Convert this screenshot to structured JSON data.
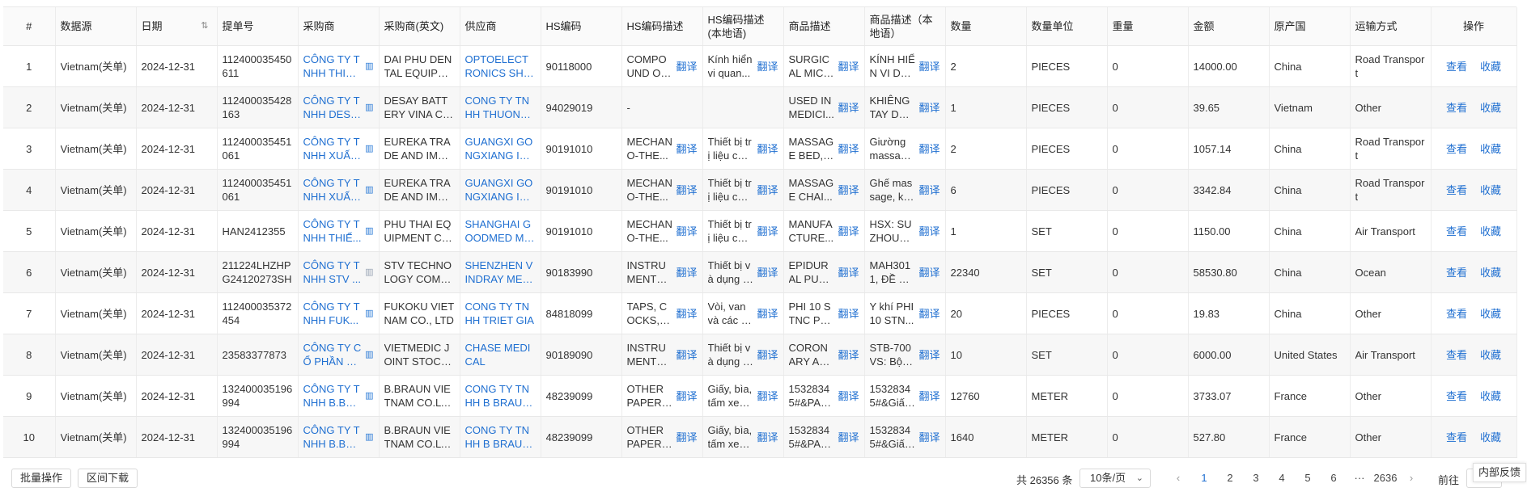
{
  "table": {
    "columns": [
      "#",
      "数据源",
      "日期",
      "提单号",
      "采购商",
      "采购商(英文)",
      "供应商",
      "HS编码",
      "HS编码描述",
      "HS编码描述\n(本地语)",
      "商品描述",
      "商品描述（本地语）",
      "数量",
      "数量单位",
      "重量",
      "金额",
      "原产国",
      "运输方式",
      "操作"
    ],
    "translate_label": "翻译",
    "view_label": "查看",
    "fav_label": "收藏",
    "rows": [
      {
        "no": "1",
        "source": "Vietnam(关单)",
        "date": "2024-12-31",
        "bill": "112400035450611",
        "buyer": "CÔNG TY TNHH THIẾT BỊ N...",
        "buyer_en": "DAI PHU DENTAL EQUIPME...",
        "supplier": "OPTOELECTRONICS SHEN...",
        "hs": "90118000",
        "hs_desc": "COMPOUND OP...",
        "hs_local": "Kính hiển vi quan...",
        "goods": "SURGICAL MICR...",
        "goods_local": "KÍNH HIỂN VI DÙ...",
        "qty": "2",
        "unit": "PIECES",
        "weight": "0",
        "amount": "14000.00",
        "origin": "China",
        "transport": "Road Transport"
      },
      {
        "no": "2",
        "source": "Vietnam(关单)",
        "date": "2024-12-31",
        "bill": "112400035428163",
        "buyer": "CÔNG TY TNHH DESAY BA...",
        "buyer_en": "DESAY BATTERY VINA CO...",
        "supplier": "CONG TY TNHH THUONG ...",
        "hs": "94029019",
        "hs_desc": "-",
        "hs_local": "",
        "goods": "USED IN MEDICI...",
        "goods_local": "KHIÊNG TAY DÙN...",
        "qty": "1",
        "unit": "PIECES",
        "weight": "0",
        "amount": "39.65",
        "origin": "Vietnam",
        "transport": "Other"
      },
      {
        "no": "3",
        "source": "Vietnam(关单)",
        "date": "2024-12-31",
        "bill": "112400035451061",
        "buyer": "CÔNG TY TNHH XUẤT NHẬ...",
        "buyer_en": "EUREKA TRADE AND IMPO...",
        "supplier": "GUANGXI GONGXIANG INT...",
        "hs": "90191010",
        "hs_desc": "MECHANO-THE...",
        "hs_local": "Thiết bị trị liệu cơ ...",
        "goods": "MASSAGE BED, ...",
        "goods_local": "Giường massage,...",
        "qty": "2",
        "unit": "PIECES",
        "weight": "0",
        "amount": "1057.14",
        "origin": "China",
        "transport": "Road Transport"
      },
      {
        "no": "4",
        "source": "Vietnam(关单)",
        "date": "2024-12-31",
        "bill": "112400035451061",
        "buyer": "CÔNG TY TNHH XUẤT NHẬ...",
        "buyer_en": "EUREKA TRADE AND IMPO...",
        "supplier": "GUANGXI GONGXIANG INT...",
        "hs": "90191010",
        "hs_desc": "MECHANO-THE...",
        "hs_local": "Thiết bị trị liệu cơ ...",
        "goods": "MASSAGE CHAI...",
        "goods_local": "Ghế massage, kt: ...",
        "qty": "6",
        "unit": "PIECES",
        "weight": "0",
        "amount": "3342.84",
        "origin": "China",
        "transport": "Road Transport"
      },
      {
        "no": "5",
        "source": "Vietnam(关单)",
        "date": "2024-12-31",
        "bill": "HAN2412355",
        "buyer": "CÔNG TY TNHH THIẾ...",
        "buyer_en": "PHU THAI EQUIPMENT CO...",
        "supplier": "SHANGHAI GOODMED MED...",
        "hs": "90191010",
        "hs_desc": "MECHANO-THE...",
        "hs_local": "Thiết bị trị liệu cơ ...",
        "goods": "MANUFACTURE...",
        "goods_local": "HSX: SUZHOU H...",
        "qty": "1",
        "unit": "SET",
        "weight": "0",
        "amount": "1150.00",
        "origin": "China",
        "transport": "Air Transport"
      },
      {
        "no": "6",
        "source": "Vietnam(关单)",
        "date": "2024-12-31",
        "bill": "211224LHZHPG24120273SH",
        "buyer": "CÔNG TY TNHH STV ...",
        "buyer_en": "STV TECHNOLOGY COMPA...",
        "supplier": "SHENZHEN VINDRAY MEDI...",
        "hs": "90183990",
        "hs_desc": "INSTRUMENTS A...",
        "hs_local": "Thiết bị và dụng cụ...",
        "goods": "EPIDURAL PUNC...",
        "goods_local": "MAH3011, ĐỀ CH...",
        "qty": "22340",
        "unit": "SET",
        "weight": "0",
        "amount": "58530.80",
        "origin": "China",
        "transport": "Ocean"
      },
      {
        "no": "7",
        "source": "Vietnam(关单)",
        "date": "2024-12-31",
        "bill": "112400035372454",
        "buyer": "CÔNG TY TNHH FUK...",
        "buyer_en": "FUKOKU VIETNAM CO., LTD",
        "supplier": "CONG TY TNHH TRIET GIA",
        "hs": "84818099",
        "hs_desc": "TAPS, COCKS, V...",
        "hs_local": "Vòi, van và các th...",
        "goods": "PHI 10 STNC PLA...",
        "goods_local": "Y khí PHI 10 STN...",
        "qty": "20",
        "unit": "PIECES",
        "weight": "0",
        "amount": "19.83",
        "origin": "China",
        "transport": "Other"
      },
      {
        "no": "8",
        "source": "Vietnam(关单)",
        "date": "2024-12-31",
        "bill": "23583377873",
        "buyer": "CÔNG TY CỔ PHẦN VI...",
        "buyer_en": "VIETMEDIC JOINT STOCK ...",
        "supplier": "CHASE MEDICAL",
        "hs": "90189090",
        "hs_desc": "INSTRUMENTS A...",
        "hs_local": "Thiết bị và dụng cụ...",
        "goods": "CORONARY ART...",
        "goods_local": "STB-700VS: Bộ c...",
        "qty": "10",
        "unit": "SET",
        "weight": "0",
        "amount": "6000.00",
        "origin": "United States",
        "transport": "Air Transport"
      },
      {
        "no": "9",
        "source": "Vietnam(关单)",
        "date": "2024-12-31",
        "bill": "132400035196994",
        "buyer": "CÔNG TY TNHH B.BR...",
        "buyer_en": "B.BRAUN VIETNAM CO.LTD",
        "supplier": "CONG TY TNHH B BRAUN ...",
        "hs": "48239099",
        "hs_desc": "OTHER PAPER, ...",
        "hs_local": "Giấy, bìa, tấm xen...",
        "goods": "15328345#&PAC...",
        "goods_local": "15328345#&Giấy ...",
        "qty": "12760",
        "unit": "METER",
        "weight": "0",
        "amount": "3733.07",
        "origin": "France",
        "transport": "Other"
      },
      {
        "no": "10",
        "source": "Vietnam(关单)",
        "date": "2024-12-31",
        "bill": "132400035196994",
        "buyer": "CÔNG TY TNHH B.BR...",
        "buyer_en": "B.BRAUN VIETNAM CO.LTD",
        "supplier": "CONG TY TNHH B BRAUN ...",
        "hs": "48239099",
        "hs_desc": "OTHER PAPER, ...",
        "hs_local": "Giấy, bìa, tấm xen...",
        "goods": "15328345#&PAC...",
        "goods_local": "15328345#&Giấy ...",
        "qty": "1640",
        "unit": "METER",
        "weight": "0",
        "amount": "527.80",
        "origin": "France",
        "transport": "Other"
      }
    ]
  },
  "footer": {
    "batch_label": "批量操作",
    "range_download_label": "区间下载",
    "total_text": "共 26356 条",
    "page_size": "10条/页",
    "pages": [
      "1",
      "2",
      "3",
      "4",
      "5",
      "6",
      "···",
      "2636"
    ],
    "current_page": "1",
    "prev_symbol": "‹",
    "next_symbol": "›",
    "goto_label": "前往",
    "feedback_label": "内部反馈"
  },
  "colors": {
    "link": "#1f6fd1",
    "row_alt": "#f7f7f7",
    "border": "#e8e8e8"
  },
  "icons": [
    "sort-icon",
    "building-icon",
    "chevron-down-icon"
  ]
}
